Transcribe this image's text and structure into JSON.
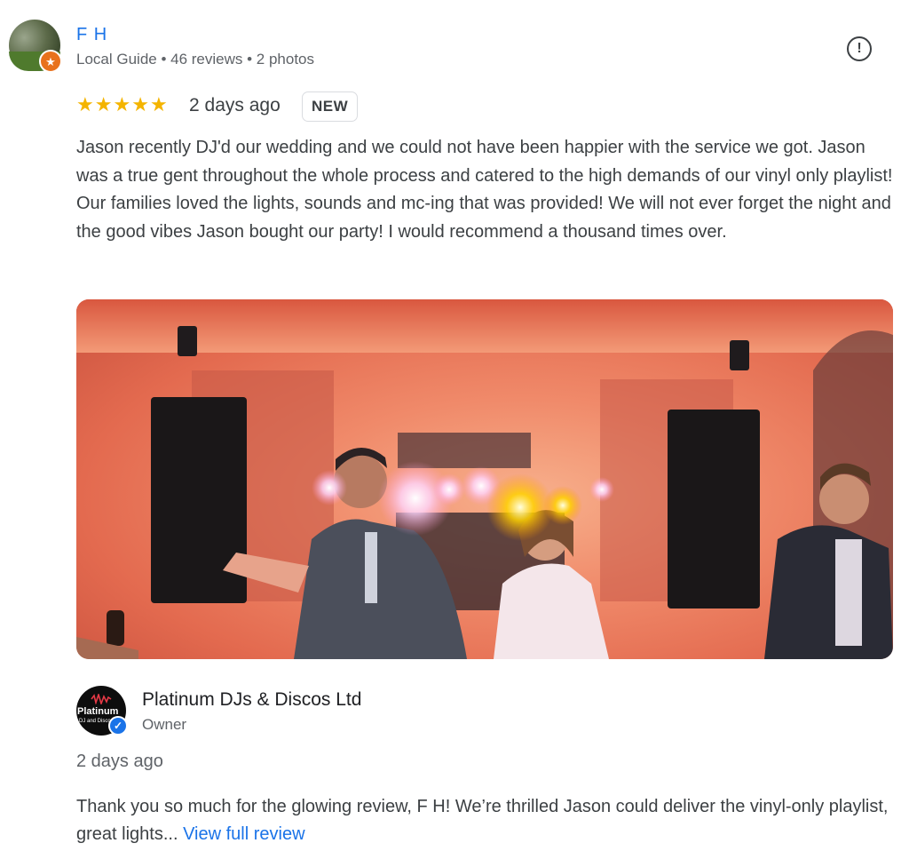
{
  "review": {
    "reviewer_name": "F H",
    "reviewer_meta": "Local Guide • 46 reviews • 2 photos",
    "rating": 5,
    "star_glyph": "★",
    "date": "2 days ago",
    "badge": "NEW",
    "text": "Jason recently DJ'd our wedding and we could not have been happier with the service we got. Jason was a true gent throughout the whole process and catered to the high demands of our vinyl only playlist! Our families loved the lights, sounds and mc-ing that was provided! We will not ever forget the night and the good vibes Jason bought our party! I would recommend a thousand times over.",
    "report_icon": "report-icon",
    "local_guide_icon": "star-badge-icon"
  },
  "owner_response": {
    "logo_text": "Platinum",
    "logo_subtext": "DJ and Disco",
    "name": "Platinum DJs & Discos Ltd",
    "role": "Owner",
    "date": "2 days ago",
    "text": "Thank you so much for the glowing review, F H! We’re thrilled Jason could deliver the vinyl-only playlist, great lights...",
    "link": "View full review",
    "verified_icon": "verified-check-icon"
  },
  "colors": {
    "link": "#1a73e8",
    "star": "#f4b400",
    "local_guide": "#e8711c"
  }
}
